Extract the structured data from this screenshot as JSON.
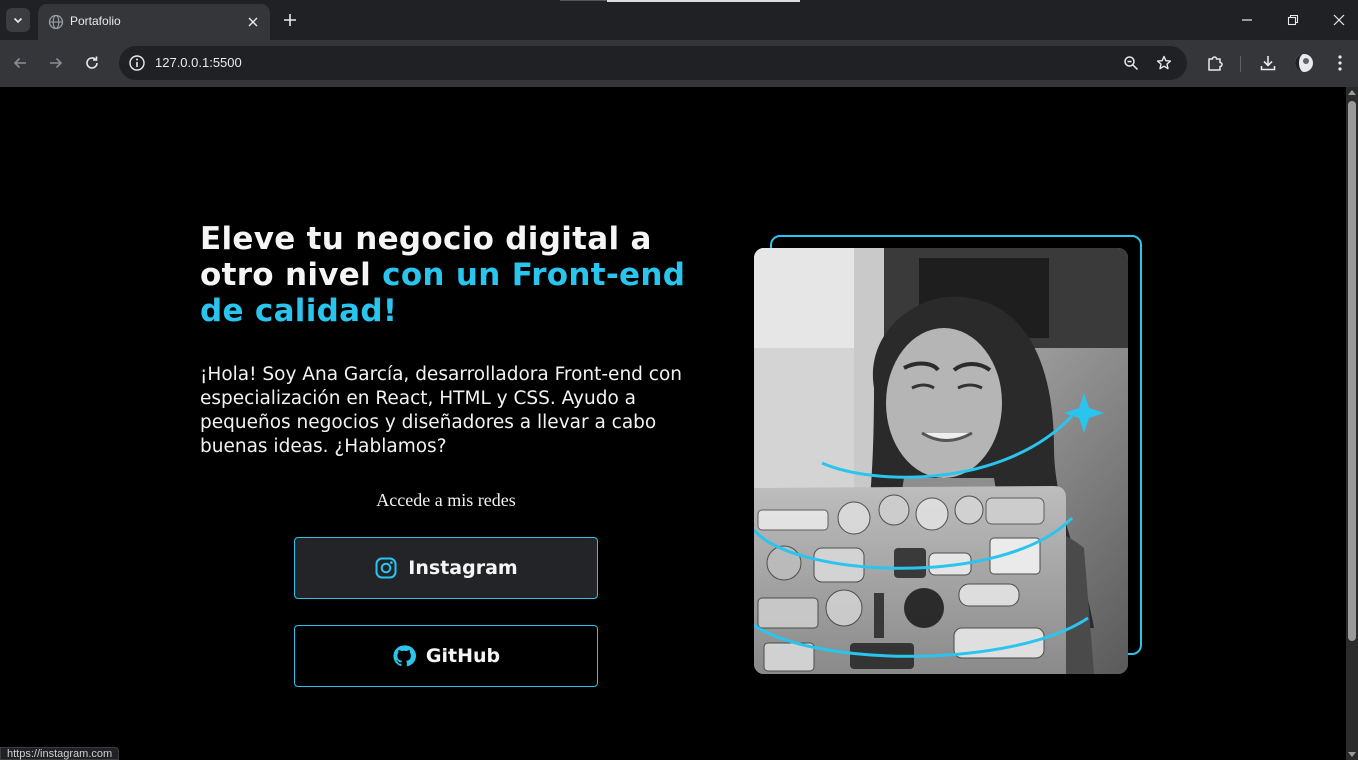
{
  "browser": {
    "tab_title": "Portafolio",
    "url": "127.0.0.1:5500",
    "status_url": "https://instagram.com"
  },
  "hero": {
    "headline_plain": "Eleve tu negocio digital a otro nivel ",
    "headline_accent": "con un Front-end de calidad!",
    "intro": "¡Hola! Soy Ana García, desarrolladora Front-end con especialización en React, HTML y CSS. Ayudo a pequeños negocios y diseñadores a llevar a cabo buenas ideas. ¿Hablamos?",
    "social_caption": "Accede a mis redes",
    "instagram_label": "Instagram",
    "github_label": "GitHub",
    "photo_alt": "Retrato de Ana García"
  },
  "colors": {
    "accent": "#2ac5ee",
    "background": "#000000",
    "text": "#f5f5f5"
  },
  "icons": [
    "tab-search-icon",
    "globe-favicon-icon",
    "close-icon",
    "plus-icon",
    "minimize-icon",
    "restore-icon",
    "back-arrow-icon",
    "forward-arrow-icon",
    "reload-icon",
    "info-icon",
    "zoom-icon",
    "star-icon",
    "extensions-icon",
    "download-icon",
    "profile-icon",
    "more-icon",
    "instagram-icon",
    "github-icon",
    "sparkle-star-icon"
  ]
}
